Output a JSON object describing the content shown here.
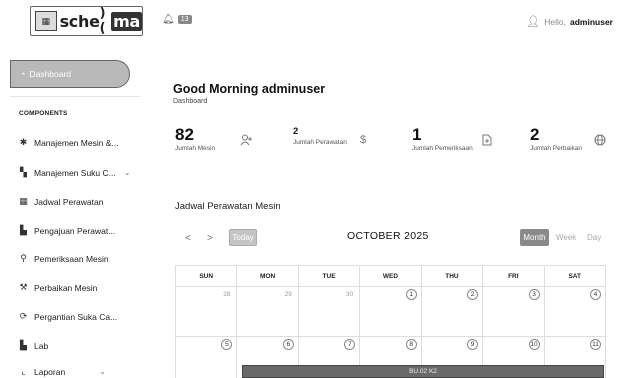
{
  "logo": {
    "text_left": "sche",
    "text_right": "ma",
    "chip_text": "▦"
  },
  "notifications": {
    "count": "13"
  },
  "user": {
    "greeting": "Hello,",
    "name": "adminuser"
  },
  "sidebar": {
    "dashboard_label": "Dashboard",
    "section_label": "COMPONENTS",
    "items": [
      {
        "label": "Manajemen Mesin &...",
        "icon": "gear-icon",
        "glyph": "✱",
        "has_chevron": false
      },
      {
        "label": "Manajemen Suku C...",
        "icon": "parts-icon",
        "glyph": "▚",
        "has_chevron": true
      },
      {
        "label": "Jadwal Perawatan",
        "icon": "calendar-icon",
        "glyph": "▦",
        "has_chevron": false
      },
      {
        "label": "Pengajuan Perawat...",
        "icon": "document-icon",
        "glyph": "▙",
        "has_chevron": false
      },
      {
        "label": "Pemeriksaan Mesin",
        "icon": "search-icon",
        "glyph": "⚲",
        "has_chevron": false
      },
      {
        "label": "Perbaikan Mesin",
        "icon": "wrench-icon",
        "glyph": "⚒",
        "has_chevron": false
      },
      {
        "label": "Pergantian Suka Ca...",
        "icon": "sync-icon",
        "glyph": "⟳",
        "has_chevron": false
      },
      {
        "label": "Lab",
        "icon": "file-icon",
        "glyph": "▙",
        "has_chevron": false
      },
      {
        "label": "Laporan",
        "icon": "chart-icon",
        "glyph": "⌞",
        "has_chevron": true
      }
    ]
  },
  "header": {
    "greeting": "Good Morning adminuser",
    "breadcrumb": "Dashboard"
  },
  "stats": [
    {
      "value": "82",
      "label": "Jumlah Mesin",
      "icon": "user-add-icon"
    },
    {
      "value": "2",
      "label": "Jumlah Perawatan",
      "icon": "dollar-icon"
    },
    {
      "value": "1",
      "label": "Jumlah Pemeriksaan",
      "icon": "document-add-icon"
    },
    {
      "value": "2",
      "label": "Jumlah Perbaikan",
      "icon": "globe-icon"
    }
  ],
  "calendar": {
    "title": "Jadwal Perawatan Mesin",
    "today_label": "Today",
    "month_label": "OCTOBER 2025",
    "views": {
      "month": "Month",
      "week": "Week",
      "day": "Day"
    },
    "weekdays": [
      "SUN",
      "MON",
      "TUE",
      "WED",
      "THU",
      "FRI",
      "SAT"
    ],
    "weeks": [
      [
        "28",
        "29",
        "30",
        "1",
        "2",
        "3",
        "4"
      ],
      [
        "5",
        "6",
        "7",
        "8",
        "9",
        "10",
        "11"
      ]
    ],
    "event_label": "BU.02 K2"
  }
}
